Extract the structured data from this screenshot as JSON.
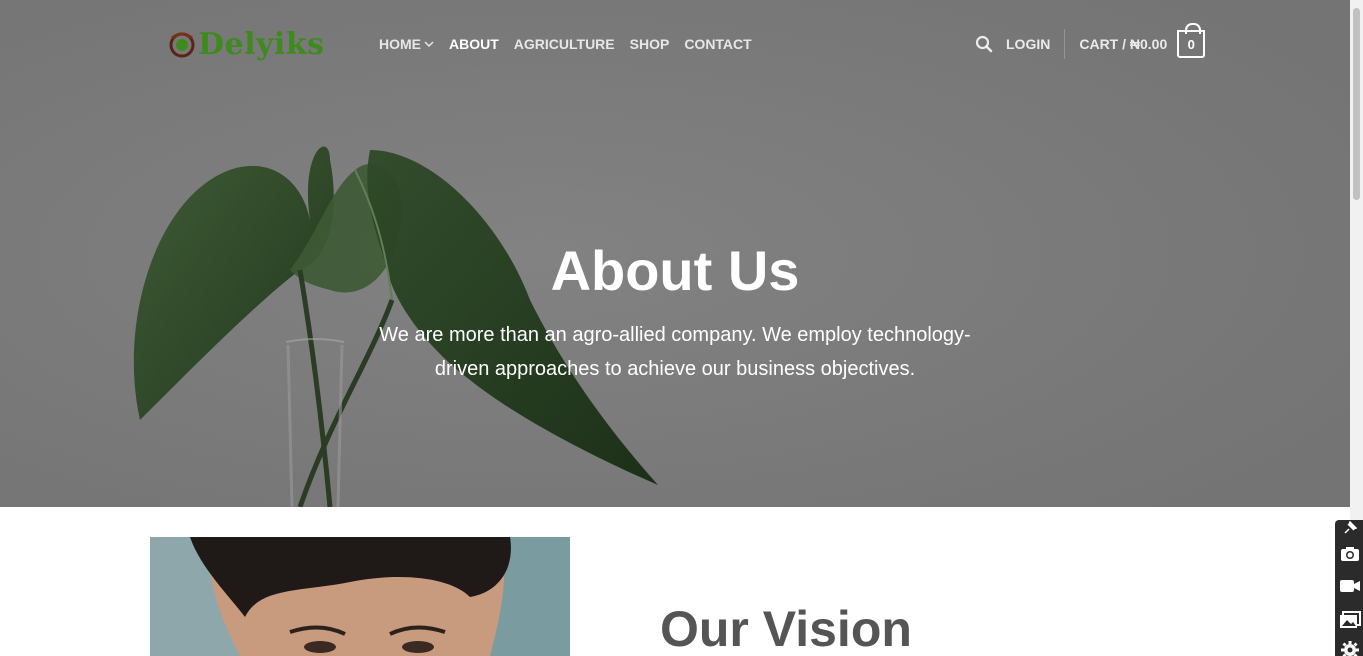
{
  "brand": {
    "logo_text": "Delyiks",
    "logo_color": "#3f8a1e"
  },
  "nav": {
    "items": [
      {
        "label": "HOME",
        "has_dropdown": true,
        "active": false
      },
      {
        "label": "ABOUT",
        "active": true
      },
      {
        "label": "AGRICULTURE",
        "active": false
      },
      {
        "label": "SHOP",
        "active": false
      },
      {
        "label": "CONTACT",
        "active": false
      }
    ]
  },
  "header_actions": {
    "search_icon": "search-icon",
    "login_label": "LOGIN",
    "cart_label": "CART / ₦0.00",
    "cart_count": "0"
  },
  "hero": {
    "title": "About Us",
    "subtitle": "We are more than an agro-allied company. We employ technology-driven approaches to achieve our business objectives."
  },
  "vision": {
    "heading": "Our Vision"
  },
  "side_tools": [
    "pin-icon",
    "camera-icon",
    "video-icon",
    "gallery-icon",
    "settings-icon"
  ],
  "colors": {
    "hero_overlay": "#7a7a7a",
    "heading_dark": "#555555",
    "white": "#ffffff"
  }
}
